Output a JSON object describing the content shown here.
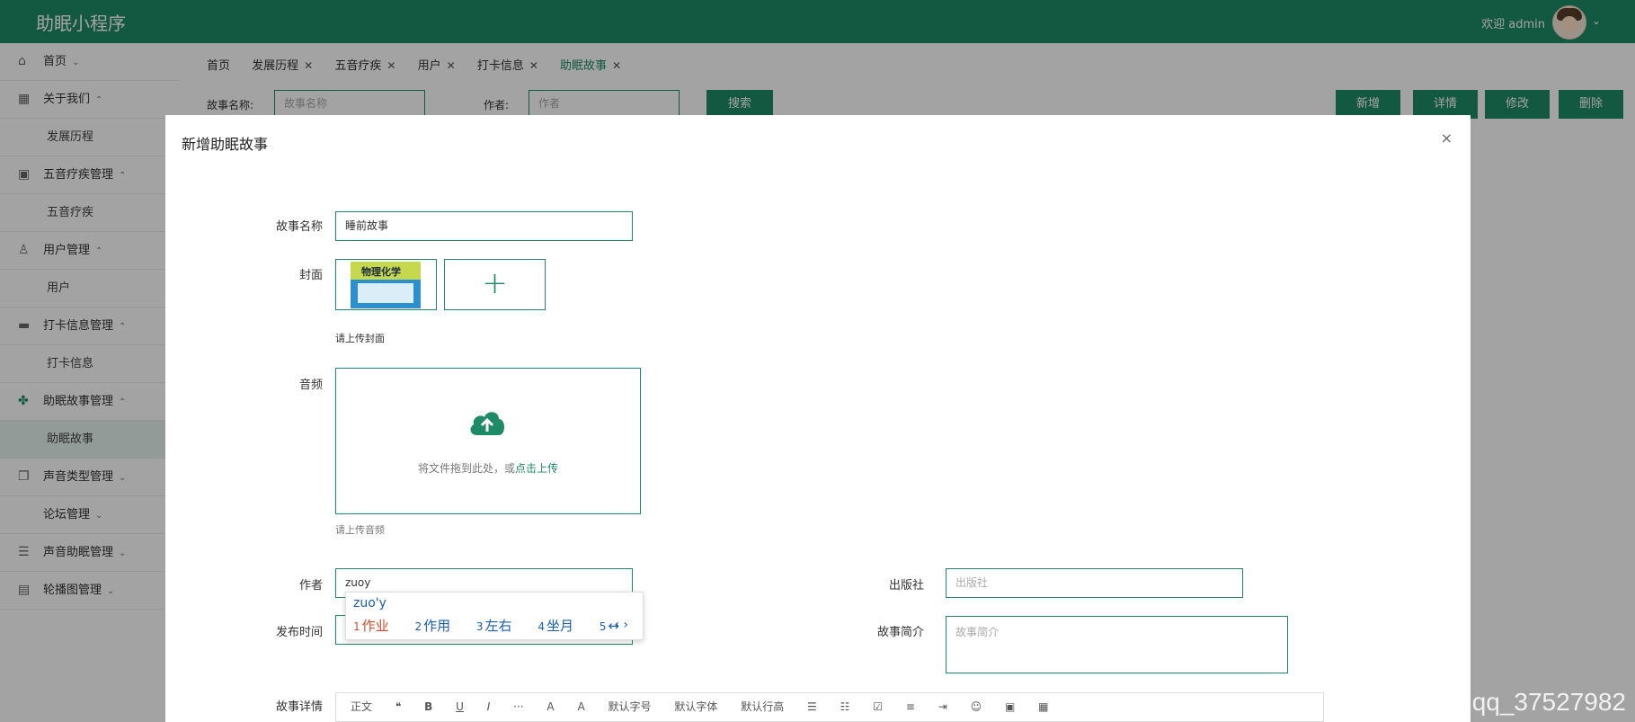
{
  "app": {
    "title": "助眠小程序",
    "welcome": "欢迎 admin"
  },
  "sidebar": {
    "items": [
      {
        "label": "首页",
        "type": "item",
        "caret": "⌄"
      },
      {
        "label": "关于我们",
        "type": "item",
        "caret": "⌃"
      },
      {
        "label": "发展历程",
        "type": "sub"
      },
      {
        "label": "五音疗疾管理",
        "type": "item",
        "caret": "⌃"
      },
      {
        "label": "五音疗疾",
        "type": "sub"
      },
      {
        "label": "用户管理",
        "type": "item",
        "caret": "⌃"
      },
      {
        "label": "用户",
        "type": "sub"
      },
      {
        "label": "打卡信息管理",
        "type": "item",
        "caret": "⌃"
      },
      {
        "label": "打卡信息",
        "type": "sub"
      },
      {
        "label": "助眠故事管理",
        "type": "item",
        "caret": "⌃"
      },
      {
        "label": "助眠故事",
        "type": "sub"
      },
      {
        "label": "声音类型管理",
        "type": "item",
        "caret": "⌄"
      },
      {
        "label": "论坛管理",
        "type": "item",
        "caret": "⌄"
      },
      {
        "label": "声音助眠管理",
        "type": "item",
        "caret": "⌄"
      },
      {
        "label": "轮播图管理",
        "type": "item",
        "caret": "⌄"
      }
    ]
  },
  "tabs": [
    "首页",
    "发展历程",
    "五音疗疾",
    "用户",
    "打卡信息",
    "助眠故事"
  ],
  "search": {
    "name_label": "故事名称:",
    "name_placeholder": "故事名称",
    "author_label": "作者:",
    "author_placeholder": "作者",
    "search_button": "搜索"
  },
  "actions": {
    "add": "新增",
    "detail": "详情",
    "edit": "修改",
    "delete": "删除"
  },
  "modal": {
    "title": "新增助眠故事",
    "close": "×",
    "story_name_label": "故事名称",
    "story_name_value": "睡前故事",
    "cover_label": "封面",
    "cover_book_title": "物理化学",
    "cover_hint": "请上传封面",
    "audio_label": "音频",
    "audio_drop_text": "将文件拖到此处，或",
    "audio_upload_link": "点击上传",
    "audio_hint": "请上传音频",
    "author_label": "作者",
    "author_value": "zuoy",
    "publisher_label": "出版社",
    "publisher_placeholder": "出版社",
    "publish_time_label": "发布时间",
    "intro_label": "故事简介",
    "intro_placeholder": "故事简介",
    "detail_label": "故事详情"
  },
  "ime": {
    "pinyin": "zuo'y",
    "candidates": [
      {
        "num": "1",
        "text": "作业"
      },
      {
        "num": "2",
        "text": "作用"
      },
      {
        "num": "3",
        "text": "左右"
      },
      {
        "num": "4",
        "text": "坐月"
      },
      {
        "num": "5",
        "text": "↔"
      }
    ]
  },
  "editor_toolbar": [
    "正文",
    "❝",
    "B",
    "U",
    "I",
    "···",
    "A",
    "A",
    "默认字号",
    "默认字体",
    "默认行高",
    "☰",
    "☷",
    "☑",
    "≡",
    "⇥",
    "☺",
    "▣",
    "▦"
  ],
  "watermark": "CSDN @qq_37527982",
  "colors": {
    "brand": "#1f8a66",
    "overlay": "rgba(0,0,0,0.36)"
  }
}
